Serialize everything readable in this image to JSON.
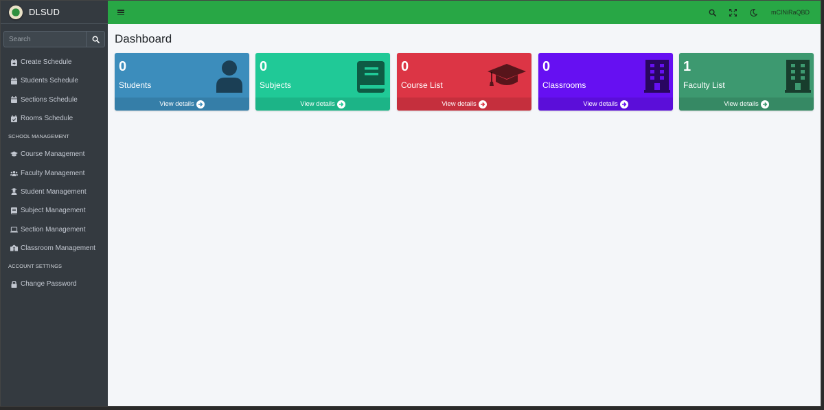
{
  "brand": {
    "name": "DLSUD"
  },
  "search": {
    "placeholder": "Search"
  },
  "sidebar": {
    "schedule_items": [
      {
        "label": "Create Schedule",
        "icon": "calendar-plus-icon"
      },
      {
        "label": "Students Schedule",
        "icon": "calendar-icon"
      },
      {
        "label": "Sections Schedule",
        "icon": "calendar-icon"
      },
      {
        "label": "Rooms Schedule",
        "icon": "calendar-check-icon"
      }
    ],
    "school_header": "SCHOOL MANAGEMENT",
    "school_items": [
      {
        "label": "Course Management",
        "icon": "graduation-cap-icon"
      },
      {
        "label": "Faculty Management",
        "icon": "users-icon"
      },
      {
        "label": "Student Management",
        "icon": "user-graduate-icon"
      },
      {
        "label": "Subject Management",
        "icon": "book-icon"
      },
      {
        "label": "Section Management",
        "icon": "laptop-icon"
      },
      {
        "label": "Classroom Management",
        "icon": "school-icon"
      }
    ],
    "account_header": "ACCOUNT SETTINGS",
    "account_items": [
      {
        "label": "Change Password",
        "icon": "lock-icon"
      }
    ]
  },
  "topbar": {
    "username": "mCINiRaQBD"
  },
  "main": {
    "title": "Dashboard",
    "cards": [
      {
        "count": "0",
        "label": "Students",
        "link": "View details",
        "color": "#3c8dbc",
        "icon": "user-icon"
      },
      {
        "count": "0",
        "label": "Subjects",
        "link": "View details",
        "color": "#20c997",
        "icon": "book-icon"
      },
      {
        "count": "0",
        "label": "Course List",
        "link": "View details",
        "color": "#dc3545",
        "icon": "graduation-cap-icon"
      },
      {
        "count": "0",
        "label": "Classrooms",
        "link": "View details",
        "color": "#6610f2",
        "icon": "building-icon"
      },
      {
        "count": "1",
        "label": "Faculty List",
        "link": "View details",
        "color": "#3d9970",
        "icon": "building-icon"
      }
    ]
  }
}
